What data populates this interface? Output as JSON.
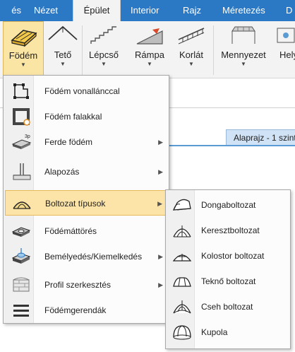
{
  "tabs": [
    {
      "label": "és"
    },
    {
      "label": "Nézet"
    },
    {
      "label": "Épület"
    },
    {
      "label": "Interior"
    },
    {
      "label": "Rajz"
    },
    {
      "label": "Méretezés"
    },
    {
      "label": "D"
    }
  ],
  "ribbon": {
    "fodem": "Födém",
    "teto": "Tető",
    "lepcso": "Lépcső",
    "rampa": "Rámpa",
    "korlat": "Korlát",
    "mennyezet": "Mennyezet",
    "hely": "Hely"
  },
  "view_tab": "Alaprajz - 1 szint",
  "main_menu": [
    {
      "label": "Födém vonallánccal"
    },
    {
      "label": "Födém falakkal"
    },
    {
      "label": "Ferde födém"
    },
    {
      "label": "Alapozás"
    },
    {
      "label": "Boltozat típusok"
    },
    {
      "label": "Födémáttörés"
    },
    {
      "label": "Bemélyedés/Kiemelkedés"
    },
    {
      "label": "Profil szerkesztés"
    },
    {
      "label": "Födémgerendák"
    }
  ],
  "sub_menu": [
    {
      "label": "Dongaboltozat"
    },
    {
      "label": "Keresztboltozat"
    },
    {
      "label": "Kolostor boltozat"
    },
    {
      "label": "Teknő boltozat"
    },
    {
      "label": "Cseh boltozat"
    },
    {
      "label": "Kupola"
    }
  ],
  "icons": {
    "ferde_badge": "3p"
  },
  "colors": {
    "tab_bar": "#2b79c5",
    "highlight": "#fce4a8",
    "view_tab": "#cfe2f6"
  }
}
